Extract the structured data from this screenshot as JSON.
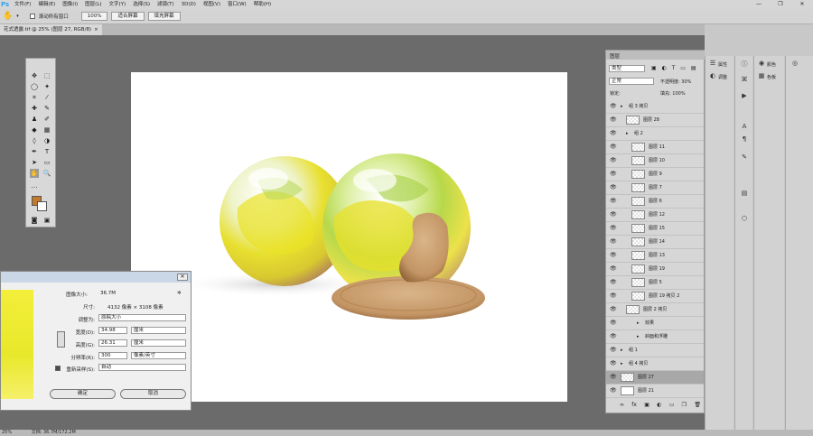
{
  "app": {
    "logo": "Ps"
  },
  "menu": [
    "文件(F)",
    "编辑(E)",
    "图像(I)",
    "图层(L)",
    "文字(Y)",
    "选择(S)",
    "滤镜(T)",
    "3D(D)",
    "视图(V)",
    "窗口(W)",
    "帮助(H)"
  ],
  "window_controls": [
    "—",
    "❐",
    "✕"
  ],
  "options": {
    "scroll_all_label": "滚动所有窗口",
    "zoom_value": "100%",
    "fit_screen": "适合屏幕",
    "fill_screen": "填充屏幕"
  },
  "doc_tab": {
    "title": "花式透露.tif @ 25% (图层 27, RGB/8)",
    "close": "×"
  },
  "dialog": {
    "close": "✕",
    "image_size_label": "图像大小:",
    "image_size_value": "36.7M",
    "gear": "✲",
    "dimensions_label": "尺寸:",
    "dimensions_value": "4132 像素 × 3108 像素",
    "fit_to_label": "调整为:",
    "fit_to_value": "原稿大小",
    "width_label": "宽度(D):",
    "width_value": "34.98",
    "width_unit": "厘米",
    "height_label": "高度(G):",
    "height_value": "26.31",
    "height_unit": "厘米",
    "resolution_label": "分辨率(R):",
    "resolution_value": "300",
    "resolution_unit": "像素/英寸",
    "resample_label": "重新采样(S):",
    "resample_value": "自动",
    "ok": "确定",
    "cancel": "取消"
  },
  "layers_panel": {
    "tab": "图层",
    "filter_kind": "类型",
    "blend_mode": "正常",
    "opacity_label": "不透明度: 30%",
    "fill_label": "填充: 100%",
    "lock_label": "锁定:",
    "rows": [
      {
        "name": "组 3 拷贝",
        "indent": 0,
        "thumb": false
      },
      {
        "name": "图层 28",
        "indent": 1,
        "thumb": true
      },
      {
        "name": "组 2",
        "indent": 1,
        "thumb": false
      },
      {
        "name": "图层 11",
        "indent": 2,
        "thumb": true
      },
      {
        "name": "图层 10",
        "indent": 2,
        "thumb": true
      },
      {
        "name": "图层 9",
        "indent": 2,
        "thumb": true
      },
      {
        "name": "图层 7",
        "indent": 2,
        "thumb": true
      },
      {
        "name": "图层 6",
        "indent": 2,
        "thumb": true
      },
      {
        "name": "图层 12",
        "indent": 2,
        "thumb": true
      },
      {
        "name": "图层 15",
        "indent": 2,
        "thumb": true
      },
      {
        "name": "图层 14",
        "indent": 2,
        "thumb": true
      },
      {
        "name": "图层 13",
        "indent": 2,
        "thumb": true
      },
      {
        "name": "图层 19",
        "indent": 2,
        "thumb": true
      },
      {
        "name": "图层 5",
        "indent": 2,
        "thumb": true
      },
      {
        "name": "图层 19 拷贝 2",
        "indent": 2,
        "thumb": true
      },
      {
        "name": "图层 2 拷贝",
        "indent": 1,
        "thumb": true
      },
      {
        "name": "效果",
        "indent": 3,
        "thumb": false
      },
      {
        "name": "斜面和浮雕",
        "indent": 3,
        "thumb": false
      },
      {
        "name": "组 1",
        "indent": 0,
        "thumb": false
      },
      {
        "name": "组 4 拷贝",
        "indent": 0,
        "thumb": false
      },
      {
        "name": "图层 27",
        "indent": 0,
        "thumb": true
      },
      {
        "name": "图层 21",
        "indent": 0,
        "thumb": true
      }
    ],
    "footer_icons": [
      "∞",
      "fx",
      "▣",
      "◐",
      "▭",
      "❒",
      "🗑"
    ]
  },
  "right_panels": {
    "properties": "属性",
    "adjustments": "调整",
    "color": "颜色",
    "swatches": "色板"
  },
  "statusbar": {
    "zoom": "25%",
    "doc_info": "文档: 36.7M/172.2M"
  },
  "colors": {
    "foreground": "#c07a2a",
    "background": "#ffffff",
    "accent": "#2fa3f0"
  }
}
